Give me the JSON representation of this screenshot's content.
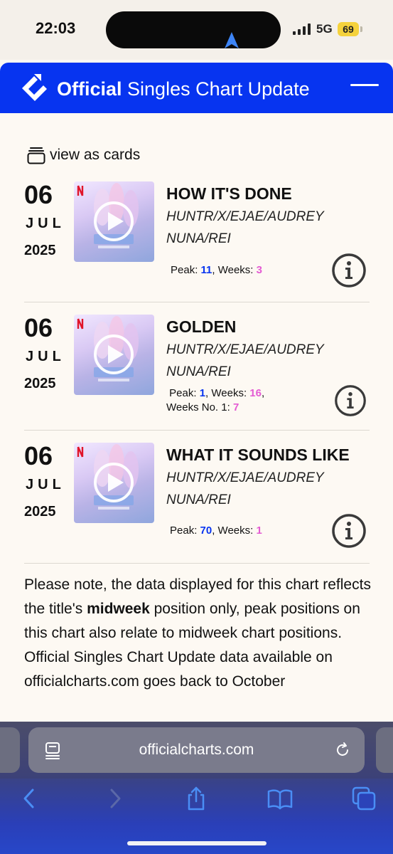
{
  "status_bar": {
    "time": "22:03",
    "network": "5G",
    "battery": "69"
  },
  "header": {
    "title_bold": "Official",
    "title_rest": " Singles Chart Update"
  },
  "view_toggle": {
    "label": "view as cards"
  },
  "entries": [
    {
      "day": "06",
      "month": "JUL",
      "year": "2025",
      "title": "HOW IT'S DONE",
      "artist": "HUNTR/X/EJAE/AUDREY NUNA/REI",
      "peak_label": "Peak: ",
      "peak": "11",
      "weeks_label": ", Weeks: ",
      "weeks": "3"
    },
    {
      "day": "06",
      "month": "JUL",
      "year": "2025",
      "title": "GOLDEN",
      "artist": "HUNTR/X/EJAE/AUDREY NUNA/REI",
      "peak_label": "Peak: ",
      "peak": "1",
      "weeks_label": ", Weeks: ",
      "weeks": "16",
      "weeks_no1_label": "Weeks No. 1: ",
      "weeks_no1": "7"
    },
    {
      "day": "06",
      "month": "JUL",
      "year": "2025",
      "title": "WHAT IT SOUNDS LIKE",
      "artist": "HUNTR/X/EJAE/AUDREY NUNA/REI",
      "peak_label": "Peak: ",
      "peak": "70",
      "weeks_label": ", Weeks: ",
      "weeks": "1"
    }
  ],
  "note": {
    "before": "Please note, the data displayed for this chart reflects the title's ",
    "bold": "midweek",
    "after": " position only, peak positions on this chart also relate to midweek chart positions. Official Singles Chart Update data available on officialcharts.com goes back to October"
  },
  "browser": {
    "url": "officialcharts.com"
  },
  "colors": {
    "brand_blue": "#0734f0",
    "peak_blue": "#0734f0",
    "weeks_pink": "#e45bd3",
    "page_bg": "#fdf9f3"
  },
  "icons": [
    "navigation-arrow-icon",
    "signal-icon",
    "battery-icon",
    "official-charts-logo",
    "menu-icon",
    "cards-icon",
    "play-icon",
    "info-icon",
    "reader-icon",
    "reload-icon",
    "back-icon",
    "forward-icon",
    "share-icon",
    "bookmarks-icon",
    "tabs-icon"
  ]
}
